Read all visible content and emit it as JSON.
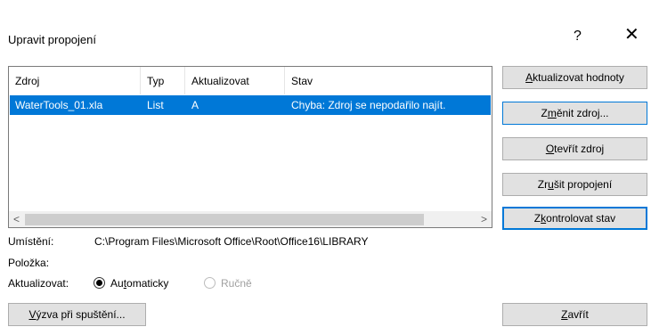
{
  "dialog": {
    "title": "Upravit propojení",
    "help_label": "?",
    "close_label": "✕"
  },
  "table": {
    "columns": [
      "Zdroj",
      "Typ",
      "Aktualizovat",
      "Stav"
    ],
    "rows": [
      {
        "zdroj": "WaterTools_01.xla",
        "typ": "List",
        "aktualizovat": "A",
        "stav": "Chyba: Zdroj se nepodařilo najít."
      }
    ],
    "selection_color": "#0078d7"
  },
  "scrollbar": {
    "left_arrow": "<",
    "right_arrow": ">"
  },
  "buttons": {
    "update_values": {
      "pre": "",
      "key": "A",
      "post": "ktualizovat hodnoty"
    },
    "change_source": {
      "pre": "Z",
      "key": "m",
      "post": "ěnit zdroj..."
    },
    "open_source": {
      "pre": "",
      "key": "O",
      "post": "tevřít zdroj"
    },
    "break_link": {
      "pre": "Zr",
      "key": "u",
      "post": "šit propojení"
    },
    "check_status": {
      "pre": "Z",
      "key": "k",
      "post": "ontrolovat stav"
    },
    "startup_prompt": {
      "pre": "",
      "key": "V",
      "post": "ýzva při spuštění..."
    },
    "close": {
      "pre": "",
      "key": "Z",
      "post": "avřít"
    }
  },
  "details": {
    "location_label": "Umístění:",
    "location_value": "C:\\Program Files\\Microsoft Office\\Root\\Office16\\LIBRARY",
    "item_label": "Položka:",
    "update_label": "Aktualizovat:",
    "automatic": {
      "pre": "Au",
      "key": "t",
      "post": "omaticky"
    },
    "manual": "Ručně"
  }
}
